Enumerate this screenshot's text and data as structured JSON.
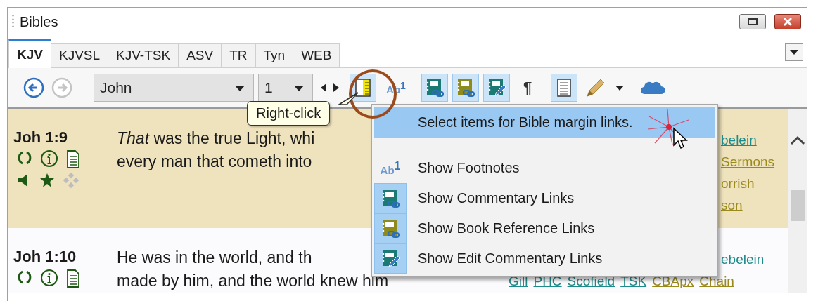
{
  "window": {
    "title": "Bibles"
  },
  "tabs": [
    {
      "label": "KJV",
      "selected": true
    },
    {
      "label": "KJVSL",
      "selected": false
    },
    {
      "label": "KJV-TSK",
      "selected": false
    },
    {
      "label": "ASV",
      "selected": false
    },
    {
      "label": "TR",
      "selected": false
    },
    {
      "label": "Tyn",
      "selected": false
    },
    {
      "label": "WEB",
      "selected": false
    }
  ],
  "toolbar": {
    "nav": [
      {
        "kind": "back",
        "disabled": false
      },
      {
        "kind": "forward",
        "disabled": true
      }
    ],
    "book": "John",
    "chapter": "1",
    "tools": [
      {
        "kind": "margin",
        "on": true
      },
      {
        "kind": "footnote",
        "glyph": "Ab$^{1}$",
        "on": false
      },
      {
        "kind": "commentary",
        "on": true
      },
      {
        "kind": "bookref",
        "on": true
      },
      {
        "kind": "editcomm",
        "on": true
      },
      {
        "kind": "pilcrow",
        "glyph": "¶",
        "on": false
      },
      {
        "kind": "page",
        "on": true
      },
      {
        "kind": "pencil",
        "on": false
      },
      {
        "kind": "cloud",
        "on": false
      }
    ]
  },
  "tooltip": {
    "text": "Right-click"
  },
  "verses": [
    {
      "ref": "Joh 1:9",
      "highlighted": true,
      "lines": [
        "*That* was the true Light, whi",
        "every man that cometh into"
      ],
      "icons": [
        {
          "kind": "parens",
          "disabled": false
        },
        {
          "kind": "info",
          "disabled": false
        },
        {
          "kind": "note",
          "disabled": false
        },
        {
          "kind": "speaker",
          "disabled": false
        },
        {
          "kind": "star",
          "disabled": false
        },
        {
          "kind": "move",
          "disabled": true
        }
      ],
      "links": [
        [
          {
            "text": "belein",
            "color": "#1f8a8a"
          }
        ],
        [
          {
            "text": "Sermons",
            "color": "#9a8a1e"
          }
        ],
        [
          {
            "text": "orrish",
            "color": "#9a8a1e"
          }
        ],
        [
          {
            "text": "son",
            "color": "#9a8a1e"
          }
        ]
      ]
    },
    {
      "ref": "Joh 1:10",
      "highlighted": false,
      "lines": [
        "He was in the world, and th",
        "made by him, and the world knew him"
      ],
      "icons": [
        {
          "kind": "parens",
          "disabled": false
        },
        {
          "kind": "info",
          "disabled": false
        },
        {
          "kind": "note",
          "disabled": false
        }
      ],
      "links": [
        [
          {
            "text": "ebelein",
            "color": "#1f8a8a"
          }
        ],
        [
          {
            "text": "Gill",
            "color": "#1f8a8a"
          },
          {
            "text": "PHC",
            "color": "#1f8a8a"
          },
          {
            "text": "Scofield",
            "color": "#1f8a8a"
          },
          {
            "text": "TSK",
            "color": "#1f8a8a"
          },
          {
            "text": "CBApx",
            "color": "#9a8a1e"
          },
          {
            "text": "Chain",
            "color": "#9a8a1e"
          }
        ]
      ]
    }
  ],
  "context_menu": {
    "items": [
      {
        "kind": "plain",
        "label": "Select items for Bible margin links.",
        "selected": true,
        "checked": false,
        "separator_after": true
      },
      {
        "kind": "footnote",
        "glyph": "Ab$^{1}$",
        "label": "Show Footnotes",
        "selected": false,
        "checked": false,
        "separator_after": false
      },
      {
        "kind": "commentary",
        "label": "Show Commentary Links",
        "selected": false,
        "checked": true,
        "separator_after": false
      },
      {
        "kind": "bookref",
        "label": "Show Book Reference Links",
        "selected": false,
        "checked": true,
        "separator_after": false
      },
      {
        "kind": "editcomm",
        "label": "Show Edit Commentary Links",
        "selected": false,
        "checked": true,
        "separator_after": false
      }
    ]
  }
}
